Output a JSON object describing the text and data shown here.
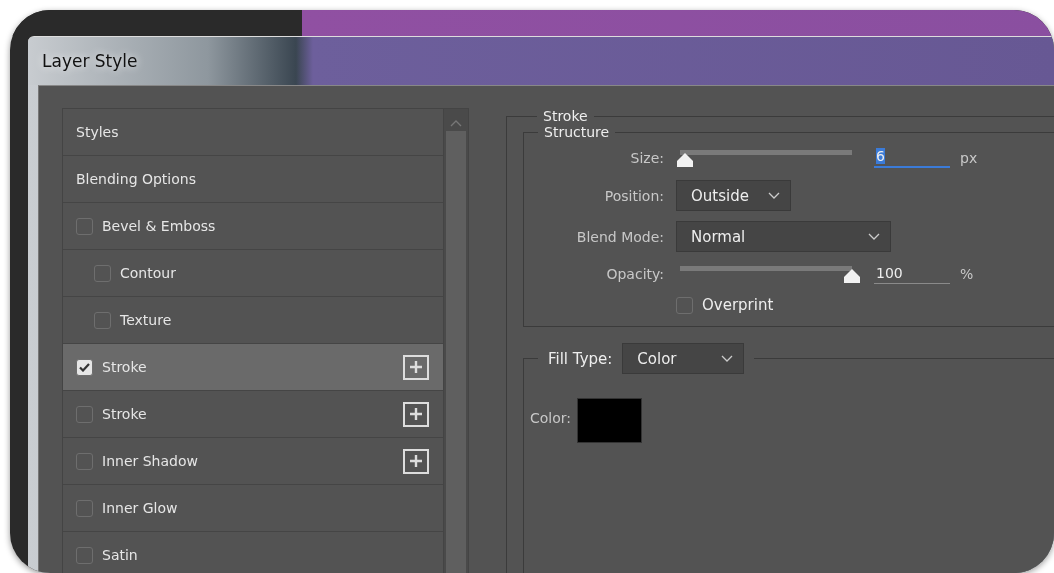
{
  "window": {
    "title": "Layer Style"
  },
  "sidebar": {
    "items": [
      {
        "label": "Styles",
        "kind": "header",
        "selected": false
      },
      {
        "label": "Blending Options",
        "kind": "header",
        "selected": false
      },
      {
        "label": "Bevel & Emboss",
        "kind": "checkbox",
        "checked": false,
        "selected": false,
        "addable": false,
        "children": [
          {
            "label": "Contour",
            "kind": "checkbox",
            "checked": false,
            "selected": false,
            "addable": false
          },
          {
            "label": "Texture",
            "kind": "checkbox",
            "checked": false,
            "selected": false,
            "addable": false
          }
        ]
      },
      {
        "label": "Stroke",
        "kind": "checkbox",
        "checked": true,
        "selected": true,
        "addable": true
      },
      {
        "label": "Stroke",
        "kind": "checkbox",
        "checked": false,
        "selected": false,
        "addable": true
      },
      {
        "label": "Inner Shadow",
        "kind": "checkbox",
        "checked": false,
        "selected": false,
        "addable": true
      },
      {
        "label": "Inner Glow",
        "kind": "checkbox",
        "checked": false,
        "selected": false,
        "addable": false
      },
      {
        "label": "Satin",
        "kind": "checkbox",
        "checked": false,
        "selected": false,
        "addable": false
      }
    ]
  },
  "panel": {
    "title": "Stroke",
    "structure": {
      "title": "Structure",
      "size": {
        "label": "Size:",
        "level": 0.03,
        "value": "6",
        "unit": "px",
        "focused": true
      },
      "position": {
        "label": "Position:",
        "value": "Outside"
      },
      "blend_mode": {
        "label": "Blend Mode:",
        "value": "Normal"
      },
      "opacity": {
        "label": "Opacity:",
        "level": 1,
        "value": "100",
        "unit": "%",
        "focused": false
      },
      "overprint": {
        "label": "Overprint",
        "checked": false
      }
    },
    "fill": {
      "label": "Fill Type:",
      "value": "Color",
      "color_label": "Color:",
      "color": "#000000"
    }
  }
}
